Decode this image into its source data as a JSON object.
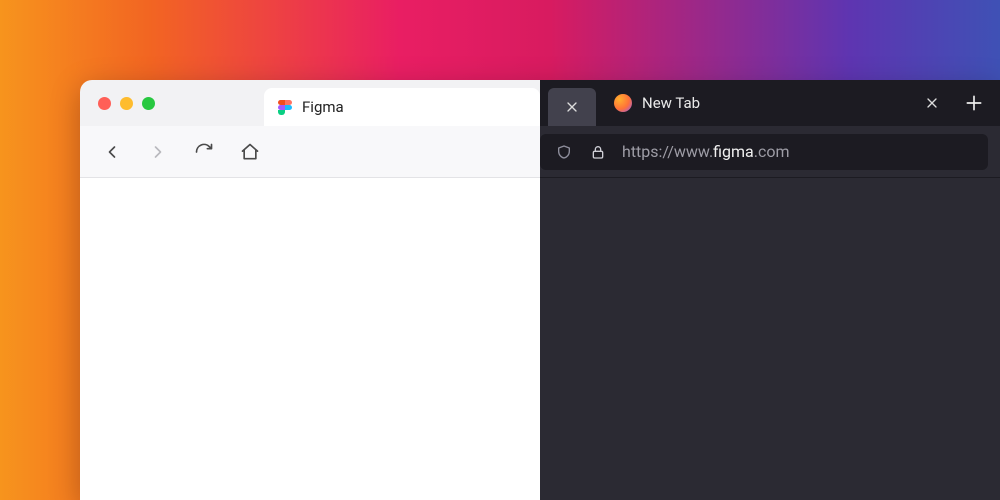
{
  "light": {
    "tab": {
      "title": "Figma",
      "icon": "figma-icon"
    },
    "nav": {
      "back": "back-icon",
      "forward": "forward-icon",
      "reload": "reload-icon",
      "home": "home-icon"
    }
  },
  "dark": {
    "active_tab": {
      "close": "×"
    },
    "inactive_tab": {
      "title": "New Tab",
      "icon": "firefox-icon",
      "close": "×"
    },
    "new_tab": "+",
    "address": {
      "shield": "shield-icon",
      "lock": "lock-icon",
      "url_prefix": "https://www.",
      "url_host": "figma",
      "url_suffix": ".com"
    }
  },
  "colors": {
    "light_chrome": "#f2f2f4",
    "dark_chrome": "#2b2a33",
    "dark_tabbar": "#1c1b22"
  }
}
